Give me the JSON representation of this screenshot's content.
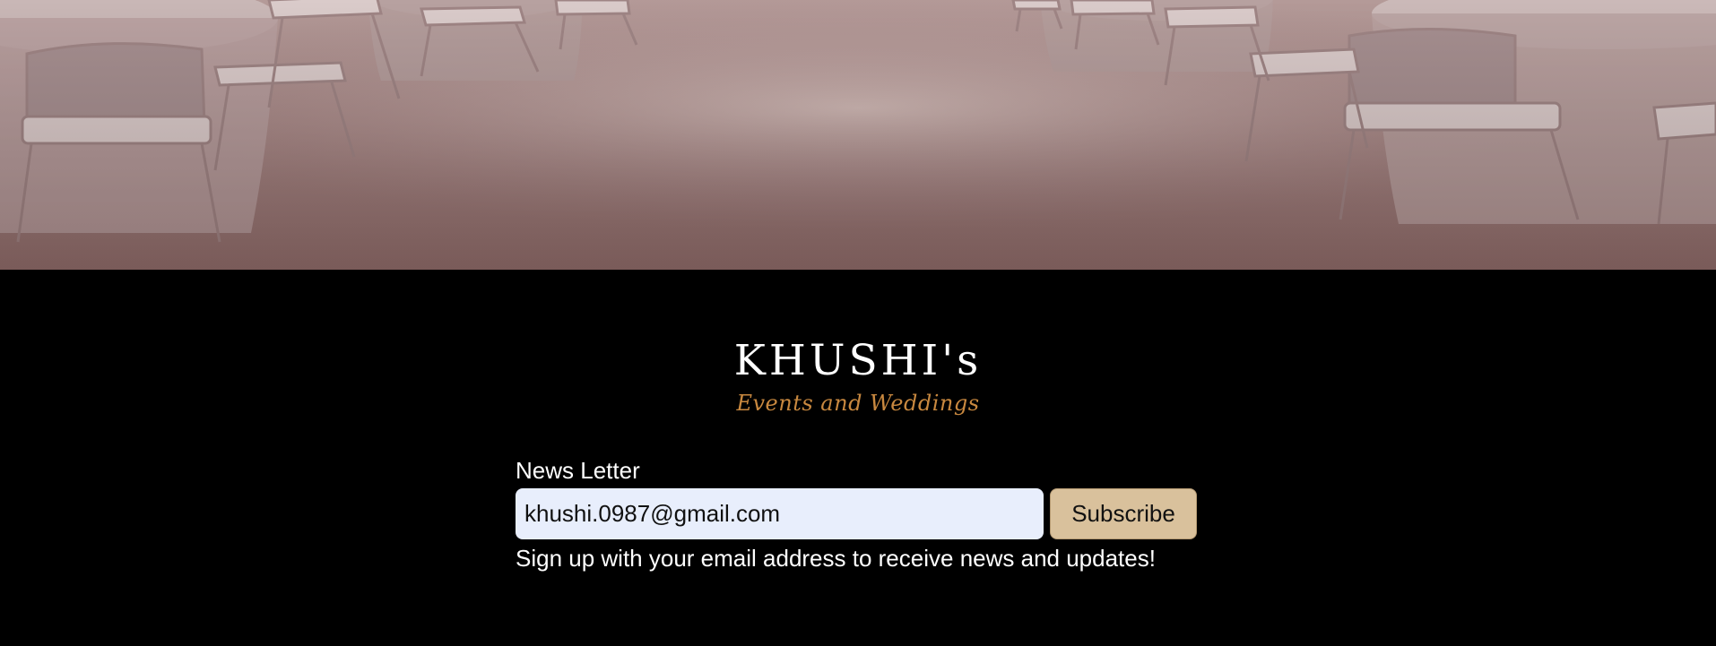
{
  "hero": {
    "image": "banquet-hall-photo",
    "colors": {
      "floor": "#b8a2a0",
      "chair": "#d8c9c9",
      "table": "#c5b3b3"
    }
  },
  "brand": {
    "name": "KHUSHI's",
    "tagline": "Events and Weddings",
    "tagline_color": "#c8883f"
  },
  "newsletter": {
    "label": "News Letter",
    "email_value": "khushi.0987@gmail.com",
    "subscribe_label": "Subscribe",
    "note": "Sign up with your email address to receive news and updates!",
    "input_bg": "#e8eefc",
    "button_bg": "#d9c19c"
  }
}
